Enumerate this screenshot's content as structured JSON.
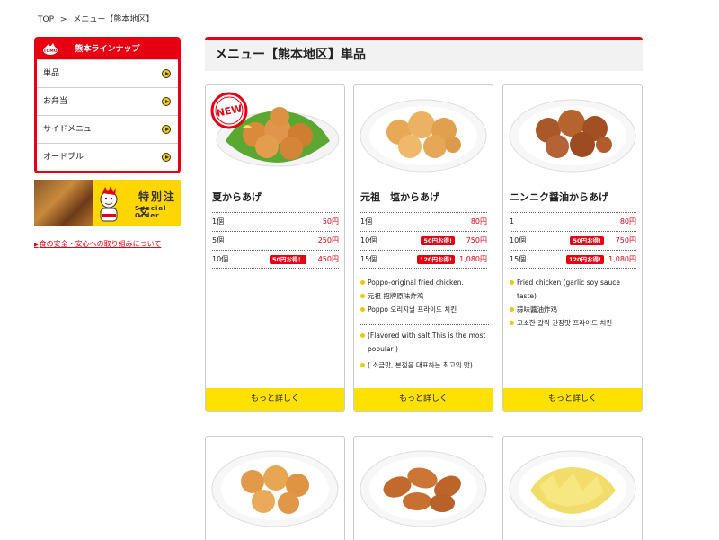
{
  "breadcrumb": {
    "top": "TOP",
    "sep": ">",
    "current": "メニュー【熊本地区】"
  },
  "sidebar": {
    "header": "熊本ラインナップ",
    "logo": "TOMO",
    "items": [
      {
        "label": "単品"
      },
      {
        "label": "お弁当"
      },
      {
        "label": "サイドメニュー"
      },
      {
        "label": "オードブル"
      }
    ],
    "banner": {
      "title": "特別注文",
      "subtitle": "Special Order"
    },
    "safety_link": "食の安全・安心への取り組みについて"
  },
  "page_title": "メニュー【熊本地区】単品",
  "products": [
    {
      "badge": "NEW",
      "name": "夏からあげ",
      "prices": [
        {
          "count": "1個",
          "deal": "",
          "price": "50円"
        },
        {
          "count": "5個",
          "deal": "",
          "price": "250円"
        },
        {
          "count": "10個",
          "deal": "50円お得！",
          "price": "450円"
        }
      ],
      "notes_a": [],
      "notes_b": [],
      "more": "もっと詳しく"
    },
    {
      "badge": "",
      "name": "元祖　塩からあげ",
      "prices": [
        {
          "count": "1個",
          "deal": "",
          "price": "80円"
        },
        {
          "count": "10個",
          "deal": "50円お得!",
          "price": "750円"
        },
        {
          "count": "15個",
          "deal": "120円お得!",
          "price": "1,080円"
        }
      ],
      "notes_a": [
        "Poppo-original fried chicken.",
        "元祖 招牌原味炸鸡",
        "Poppo 오리지널 프라이드 치킨"
      ],
      "notes_b": [
        "(Flavored with salt.This is the most popular )",
        "( 소금맛, 본점을 대표하는 최고의 맛)"
      ],
      "more": "もっと詳しく"
    },
    {
      "badge": "",
      "name": "ニンニク醤油からあげ",
      "prices": [
        {
          "count": "1",
          "deal": "",
          "price": "80円"
        },
        {
          "count": "10個",
          "deal": "50円お得!",
          "price": "750円"
        },
        {
          "count": "15個",
          "deal": "120円お得!",
          "price": "1,080円"
        }
      ],
      "notes_a": [
        "Fried chicken (garlic soy sauce taste)",
        "蒜味醬油炸鸡",
        "고소한 갈릭 간장맛 프라이드 치킨"
      ],
      "notes_b": [],
      "more": "もっと詳しく"
    }
  ],
  "icons": {
    "arrow": "circle-arrow-right-icon",
    "brand": "#e60012",
    "accent": "#ffe100"
  }
}
